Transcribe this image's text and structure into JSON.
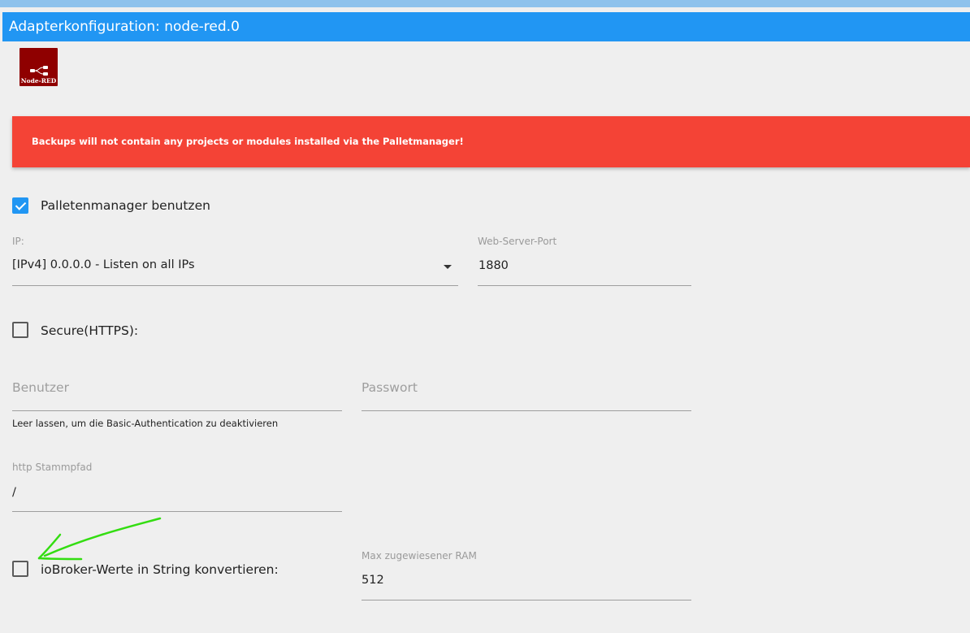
{
  "window": {
    "title": "Adapterkonfiguration: node-red.0"
  },
  "logo": {
    "text": "Node-RED",
    "icon": "node-red-flow-icon"
  },
  "alert": {
    "text": "Backups will not contain any projects or modules installed via the Palletmanager!",
    "color": "#f44336"
  },
  "palette_manager": {
    "label": "Palletenmanager benutzen",
    "checked": true
  },
  "ip": {
    "label": "IP:",
    "value": "[IPv4] 0.0.0.0 - Listen on all IPs"
  },
  "port": {
    "label": "Web-Server-Port",
    "value": "1880"
  },
  "secure": {
    "label": "Secure(HTTPS):",
    "checked": false
  },
  "user": {
    "placeholder": "Benutzer",
    "helper": "Leer lassen, um die Basic-Authentication zu deaktivieren"
  },
  "password": {
    "placeholder": "Passwort"
  },
  "http_root": {
    "label": "http Stammpfad",
    "value": "/"
  },
  "convert_strings": {
    "label": "ioBroker-Werte in String konvertieren:",
    "checked": false
  },
  "max_ram": {
    "label": "Max zugewiesener RAM",
    "value": "512"
  },
  "theme": {
    "accent": "#2196f3",
    "annotation": "#33dd11"
  }
}
